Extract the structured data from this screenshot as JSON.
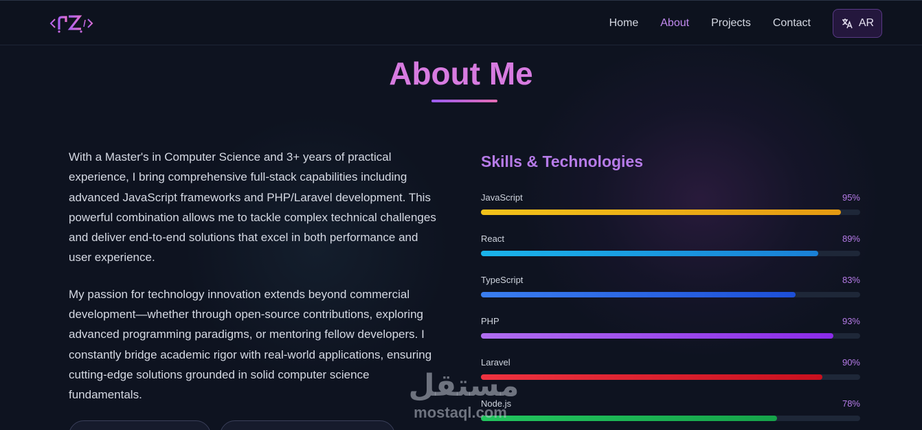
{
  "header": {
    "nav": [
      {
        "label": "Home",
        "active": false
      },
      {
        "label": "About",
        "active": true
      },
      {
        "label": "Projects",
        "active": false
      },
      {
        "label": "Contact",
        "active": false
      }
    ],
    "lang_button": {
      "label": "AR",
      "icon": "translate-icon"
    }
  },
  "about": {
    "title": "About Me",
    "paragraphs": [
      "With a Master's in Computer Science and 3+ years of practical experience, I bring comprehensive full-stack capabilities including advanced JavaScript frameworks and PHP/Laravel development. This powerful combination allows me to tackle complex technical challenges and deliver end-to-end solutions that excel in both performance and user experience.",
      "My passion for technology innovation extends beyond commercial development—whether through open-source contributions, exploring advanced programming paradigms, or mentoring fellow developers. I constantly bridge academic rigor with real-world applications, ensuring cutting-edge solutions grounded in solid computer science fundamentals."
    ]
  },
  "skills": {
    "title": "Skills & Technologies",
    "items": [
      {
        "name": "JavaScript",
        "percent_label": "95%",
        "level": 0.95,
        "colors": [
          "#f2c21a",
          "#e59a12"
        ]
      },
      {
        "name": "React",
        "percent_label": "89%",
        "level": 0.89,
        "colors": [
          "#1ab4ea",
          "#1a80d6"
        ]
      },
      {
        "name": "TypeScript",
        "percent_label": "83%",
        "level": 0.83,
        "colors": [
          "#3a7ef0",
          "#1d4fd8"
        ]
      },
      {
        "name": "PHP",
        "percent_label": "93%",
        "level": 0.93,
        "colors": [
          "#b06ef0",
          "#8a2be8"
        ]
      },
      {
        "name": "Laravel",
        "percent_label": "90%",
        "level": 0.9,
        "colors": [
          "#ef3340",
          "#c8101e"
        ]
      },
      {
        "name": "Node.js",
        "percent_label": "78%",
        "level": 0.78,
        "colors": [
          "#22c55e",
          "#16a34a"
        ]
      }
    ]
  },
  "watermark": {
    "arabic": "مستقل",
    "latin": "mostaql.com"
  },
  "colors": {
    "accent": "#c28af0",
    "title": "#d77be0",
    "background": "#0e1320"
  }
}
